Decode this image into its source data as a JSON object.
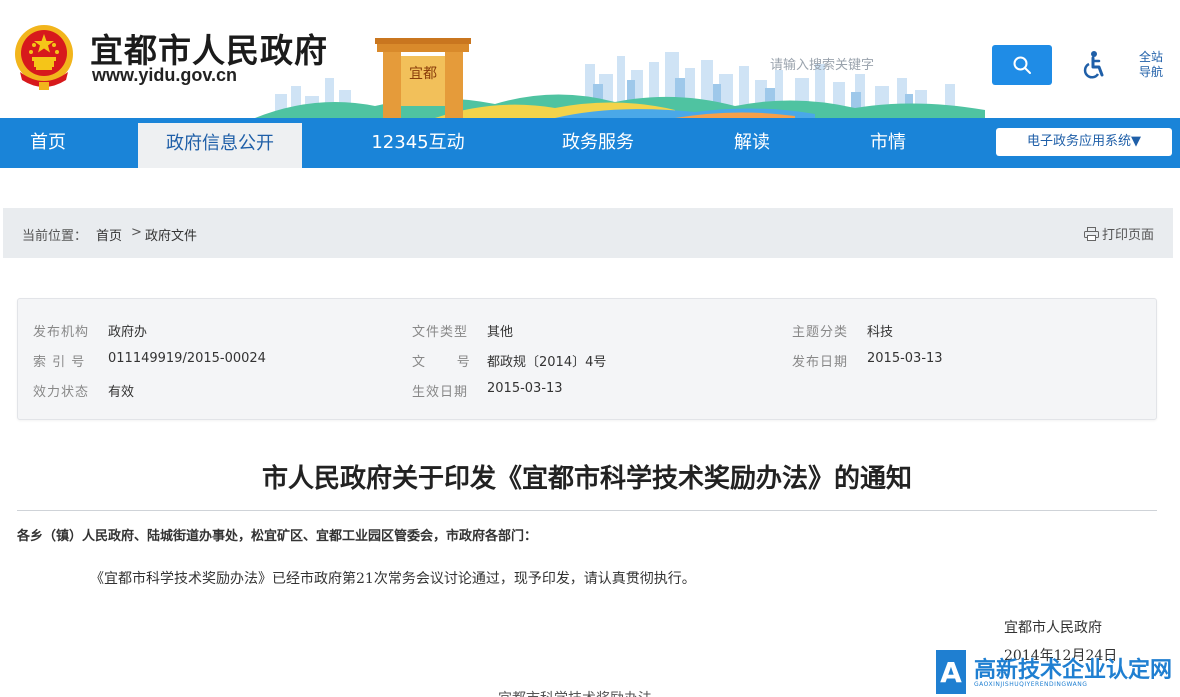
{
  "header": {
    "site_title": "宜都市人民政府",
    "site_url": "www.yidu.gov.cn",
    "search_placeholder": "请输入搜索关键字",
    "nav_all_line1": "全站",
    "nav_all_line2": "导航",
    "emblem_icon": "national-emblem-icon",
    "gate_text": "宜都"
  },
  "nav": {
    "items": [
      {
        "label": "首页"
      },
      {
        "label": "政府信息公开"
      },
      {
        "label": "12345互动"
      },
      {
        "label": "政务服务"
      },
      {
        "label": "解读"
      },
      {
        "label": "市情"
      }
    ],
    "dropdown_label": "电子政务应用系统▼"
  },
  "breadcrumb": {
    "prefix": "当前位置：",
    "home": "首页",
    "separator": ">",
    "current": "政府文件",
    "print_label": "打印页面"
  },
  "meta": {
    "issuer_label": "发布机构",
    "issuer_value": "政府办",
    "index_label": "索 引 号",
    "index_value": "011149919/2015-00024",
    "validity_label": "效力状态",
    "validity_value": "有效",
    "type_label": "文件类型",
    "type_value": "其他",
    "docno_label": "文      号",
    "docno_value": "都政规〔2014〕4号",
    "effective_label": "生效日期",
    "effective_value": "2015-03-13",
    "topic_label": "主题分类",
    "topic_value": "科技",
    "publish_label": "发布日期",
    "publish_value": "2015-03-13"
  },
  "document": {
    "title": "市人民政府关于印发《宜都市科学技术奖励办法》的通知",
    "addressee": "各乡（镇）人民政府、陆城街道办事处，松宜矿区、宜都工业园区管委会，市政府各部门：",
    "body": "《宜都市科学技术奖励办法》已经市政府第21次常务会议讨论通过，现予印发，请认真贯彻执行。",
    "sign_org": "宜都市人民政府",
    "sign_date": "2014年12月24日",
    "next_line": "宜都市科学技术奖励办法"
  },
  "watermark": {
    "text": "高新技术企业认定网",
    "sub": "GAOXINJISHUQIYERENDINGWANG",
    "logo_letter": "A"
  },
  "colors": {
    "primary": "#1a84d8",
    "search_button": "#1f8ce6",
    "emblem_red": "#d7191c",
    "emblem_gold": "#f5c518"
  }
}
